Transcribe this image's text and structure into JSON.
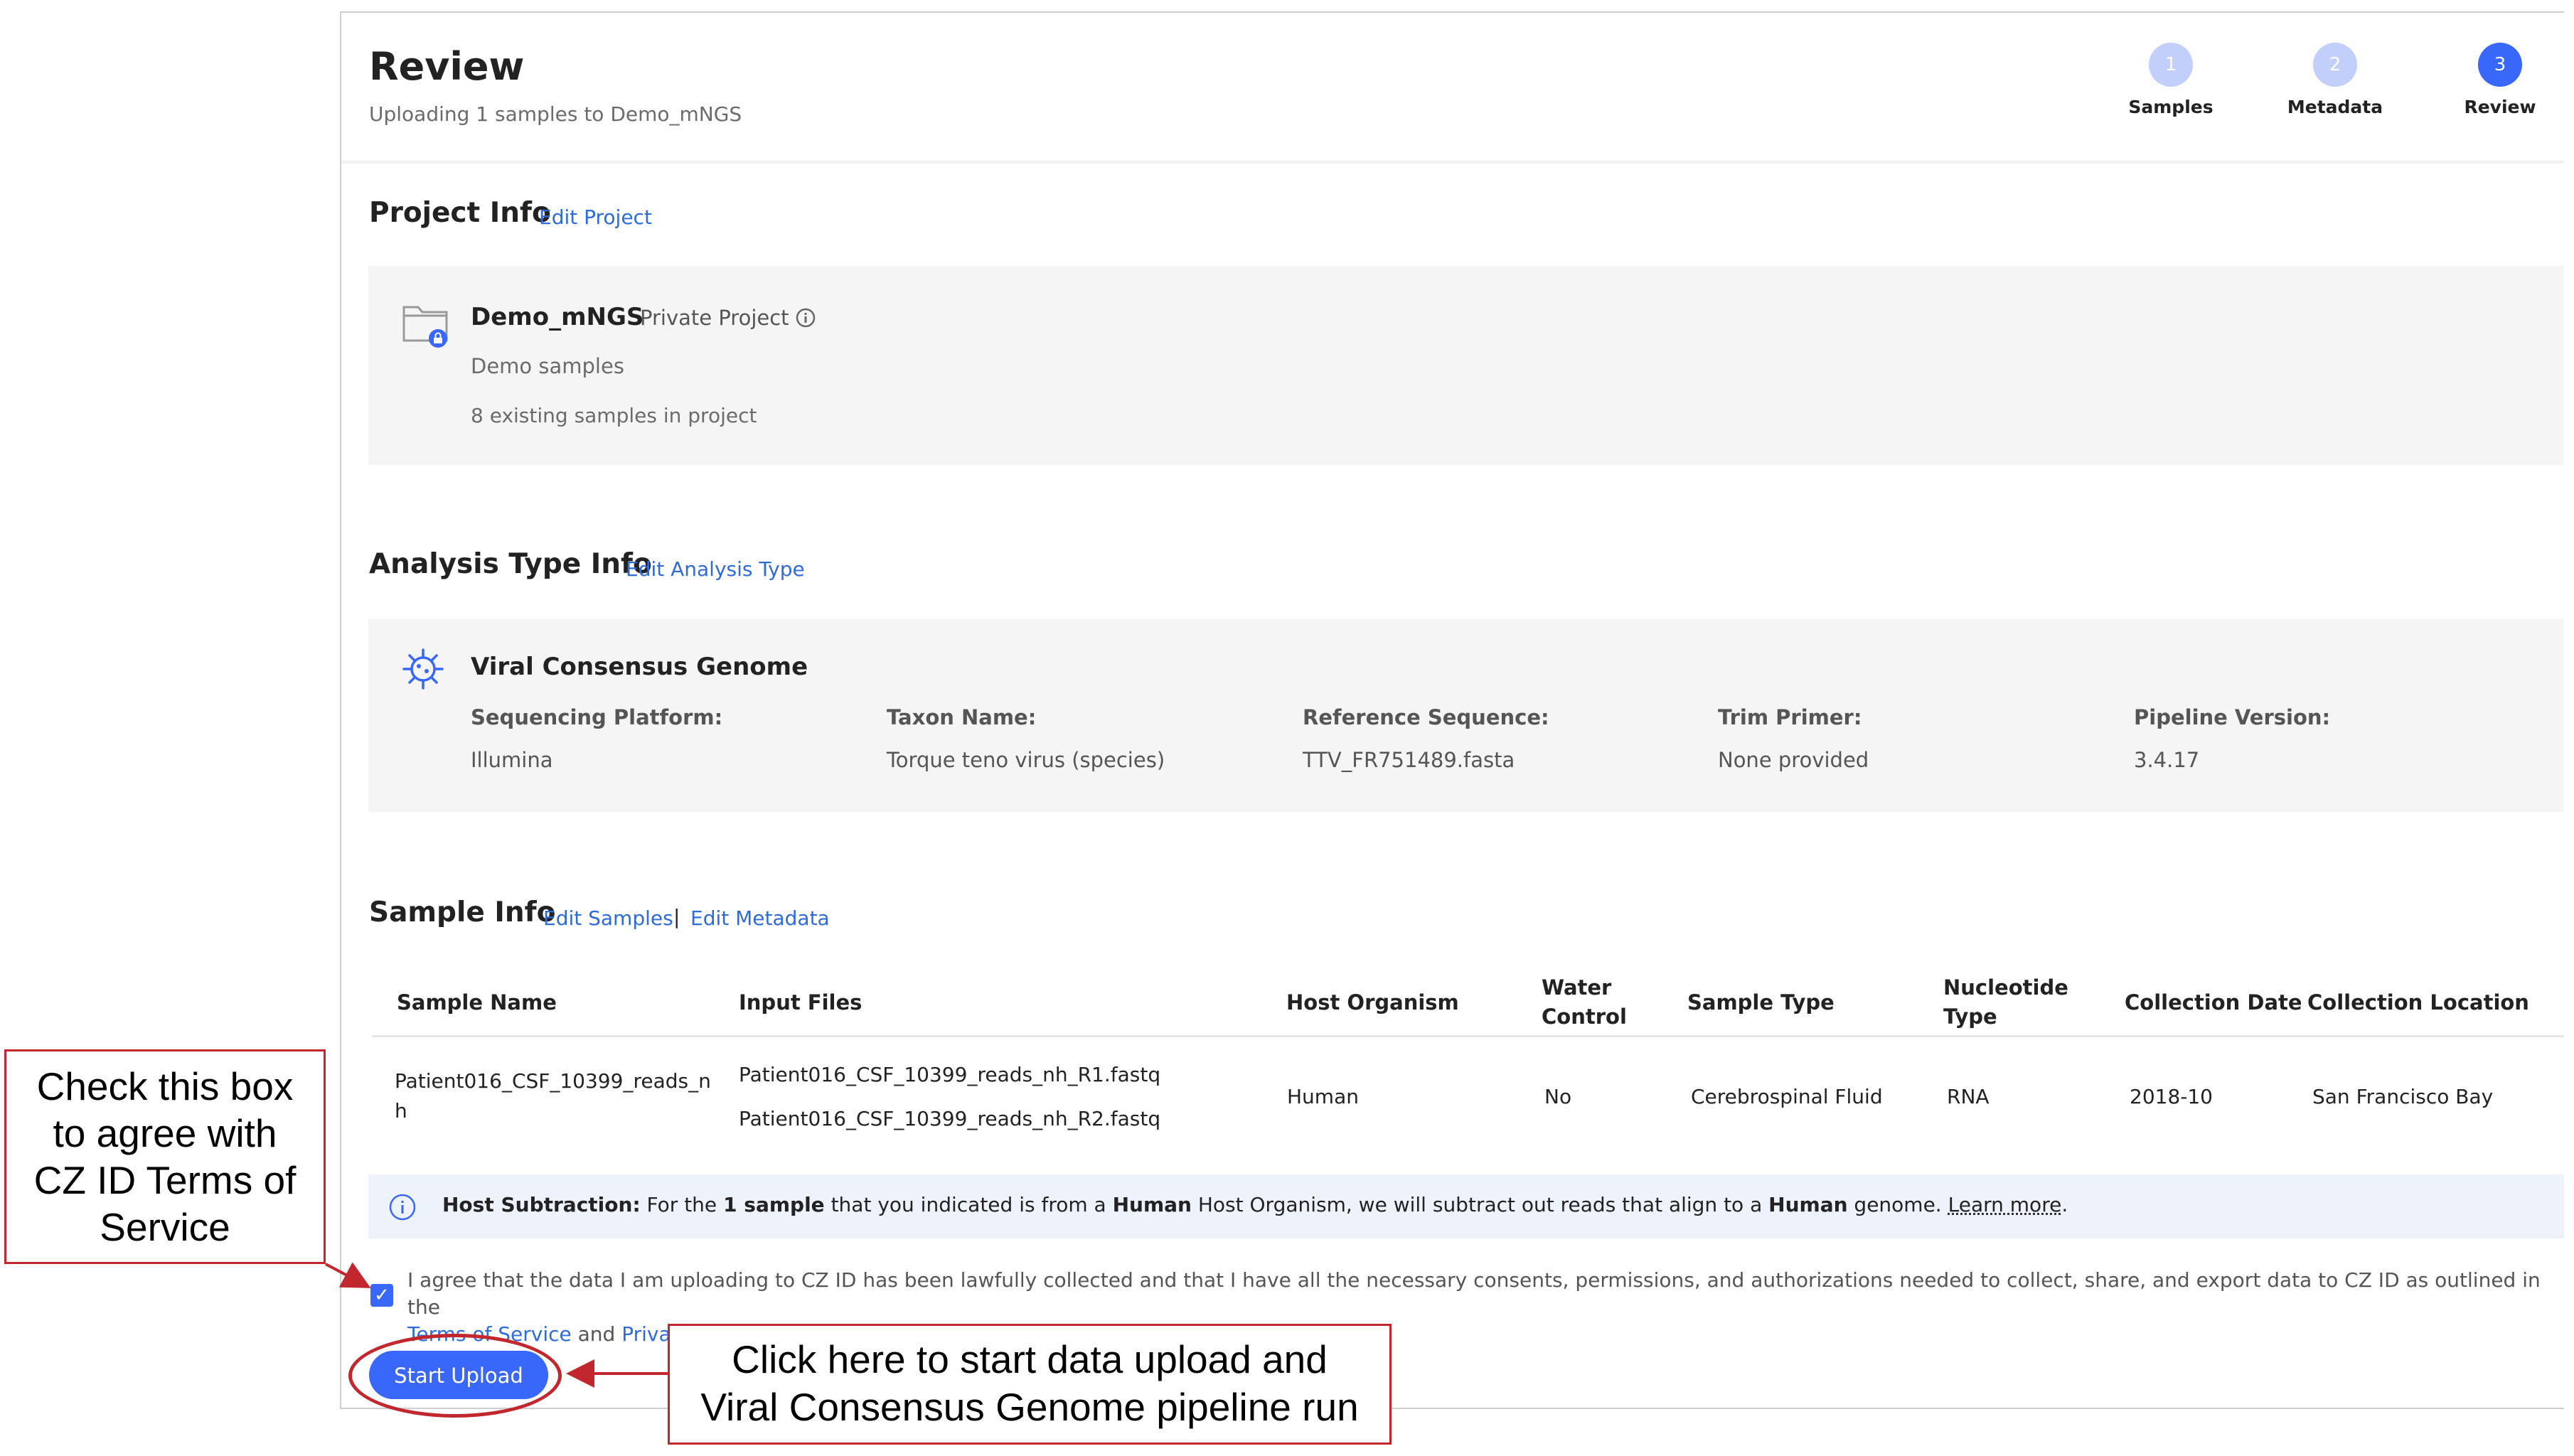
{
  "header": {
    "title": "Review",
    "subtitle": "Uploading 1 samples to Demo_mNGS",
    "steps": [
      {
        "num": "1",
        "label": "Samples"
      },
      {
        "num": "2",
        "label": "Metadata"
      },
      {
        "num": "3",
        "label": "Review"
      }
    ]
  },
  "project": {
    "section_title": "Project Info",
    "edit_link": "Edit Project",
    "name": "Demo_mNGS",
    "privacy": "Private Project",
    "description": "Demo samples",
    "existing": "8 existing samples in project"
  },
  "analysis": {
    "section_title": "Analysis Type Info",
    "edit_link": "Edit Analysis Type",
    "type_name": "Viral Consensus Genome",
    "fields": [
      {
        "label": "Sequencing Platform:",
        "value": "Illumina"
      },
      {
        "label": "Taxon Name:",
        "value": "Torque teno virus (species)"
      },
      {
        "label": "Reference Sequence:",
        "value": "TTV_FR751489.fasta"
      },
      {
        "label": "Trim Primer:",
        "value": "None provided"
      },
      {
        "label": "Pipeline Version:",
        "value": "3.4.17"
      }
    ]
  },
  "samples": {
    "section_title": "Sample Info",
    "edit_samples": "Edit Samples",
    "separator": "|",
    "edit_metadata": "Edit Metadata",
    "columns": {
      "sample_name": "Sample Name",
      "input_files": "Input Files",
      "host_organism": "Host Organism",
      "water_control_1": "Water",
      "water_control_2": "Control",
      "sample_type": "Sample Type",
      "nucleotide_type_1": "Nucleotide",
      "nucleotide_type_2": "Type",
      "collection_date": "Collection Date",
      "collection_location": "Collection Location"
    },
    "row": {
      "sample_name_1": "Patient016_CSF_10399_reads_n",
      "sample_name_2": "h",
      "file_1": "Patient016_CSF_10399_reads_nh_R1.fastq",
      "file_2": "Patient016_CSF_10399_reads_nh_R2.fastq",
      "host_organism": "Human",
      "water_control": "No",
      "sample_type": "Cerebrospinal Fluid",
      "nucleotide_type": "RNA",
      "collection_date": "2018-10",
      "collection_location": "San Francisco Bay"
    }
  },
  "host_subtraction": {
    "label": "Host Subtraction:",
    "t1": " For the ",
    "b1": "1 sample",
    "t2": " that you indicated is from a ",
    "b2": "Human",
    "t3": " Host Organism, we will subtract out reads that align to a ",
    "b3": "Human",
    "t4": " genome. ",
    "learn_more": "Learn more",
    "t5": "."
  },
  "agreement": {
    "text": "I agree that the data I am uploading to CZ ID has been lawfully collected and that I have all the necessary consents, permissions, and authorizations needed to collect, share, and export data to CZ ID as outlined in the",
    "terms": "Terms of Service",
    "and": " and ",
    "privacy": "Privacy Policy",
    "end": ".",
    "checked": true
  },
  "start_button": "Start Upload",
  "annotations": {
    "checkbox_note": [
      "Check this box",
      "to agree with",
      "CZ ID Terms of",
      "Service"
    ],
    "button_note": [
      "Click here to start data upload and",
      "Viral Consensus Genome pipeline run"
    ]
  },
  "colors": {
    "accent": "#3867fa",
    "link": "#2f6bd9",
    "step_inactive": "#c3cffb",
    "annotation_red": "#c1272d"
  }
}
